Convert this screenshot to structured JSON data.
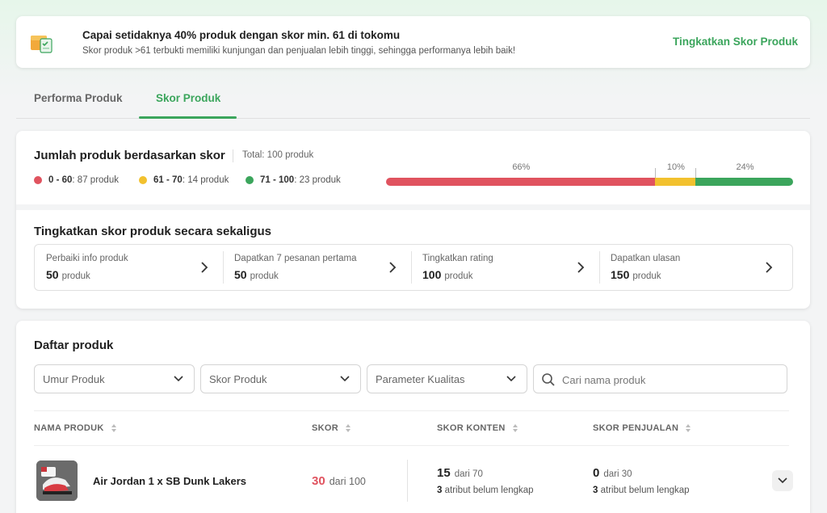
{
  "colors": {
    "accent": "#3ba55c",
    "red": "#e0535f",
    "yellow": "#f2c12e",
    "green": "#3ba55c"
  },
  "banner": {
    "icon": "score-box-icon",
    "title": "Capai setidaknya 40% produk dengan skor min. 61 di tokomu",
    "subtitle": "Skor produk >61 terbukti memiliki kunjungan dan penjualan lebih tinggi, sehingga performanya lebih baik!",
    "link": "Tingkatkan Skor Produk"
  },
  "tabs": [
    {
      "label": "Performa Produk",
      "active": false
    },
    {
      "label": "Skor Produk",
      "active": true
    }
  ],
  "score_summary": {
    "title": "Jumlah produk berdasarkan skor",
    "total": "Total: 100 produk",
    "legend": [
      {
        "range": "0 - 60",
        "count": ": 87 produk",
        "color": "#e0535f"
      },
      {
        "range": "61 - 70",
        "count": ": 14 produk",
        "color": "#f2c12e"
      },
      {
        "range": "71 - 100",
        "count": ": 23 produk",
        "color": "#3ba55c"
      }
    ],
    "bar": [
      {
        "label": "66%",
        "value": 66,
        "color": "#e0535f"
      },
      {
        "label": "10%",
        "value": 10,
        "color": "#f2c12e"
      },
      {
        "label": "24%",
        "value": 24,
        "color": "#3ba55c"
      }
    ]
  },
  "bulk": {
    "title": "Tingkatkan skor produk secara sekaligus",
    "actions": [
      {
        "label": "Perbaiki info produk",
        "value": "50",
        "unit": "produk"
      },
      {
        "label": "Dapatkan 7 pesanan pertama",
        "value": "50",
        "unit": "produk"
      },
      {
        "label": "Tingkatkan rating",
        "value": "100",
        "unit": "produk"
      },
      {
        "label": "Dapatkan ulasan",
        "value": "150",
        "unit": "produk"
      }
    ]
  },
  "list": {
    "title": "Daftar produk",
    "filters": [
      "Umur Produk",
      "Skor Produk",
      "Parameter Kualitas"
    ],
    "search_placeholder": "Cari nama produk",
    "columns": [
      "NAMA PRODUK",
      "SKOR",
      "SKOR KONTEN",
      "SKOR PENJUALAN"
    ],
    "rows": [
      {
        "name": "Air Jordan 1 x SB Dunk Lakers",
        "score": "30",
        "score_of": "dari 100",
        "content_score": "15",
        "content_of": "dari 70",
        "content_missing_count": "3",
        "content_missing_text": " atribut belum lengkap",
        "sales_score": "0",
        "sales_of": "dari 30",
        "sales_missing_count": "3",
        "sales_missing_text": " atribut belum lengkap"
      }
    ]
  }
}
